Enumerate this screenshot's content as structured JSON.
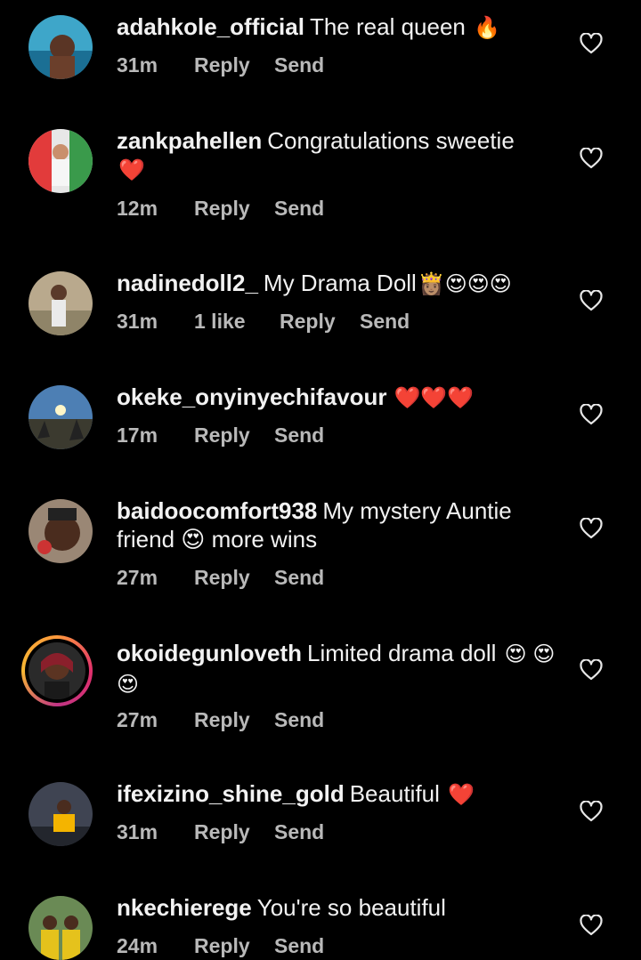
{
  "comments": [
    {
      "username": "adahkole_official",
      "text": "The real queen",
      "emoji": "🔥",
      "time": "31m",
      "likes": "",
      "reply": "Reply",
      "send": "Send"
    },
    {
      "username": "zankpahellen",
      "text": "Congratulations sweetie",
      "emoji": "❤️",
      "time": "12m",
      "likes": "",
      "reply": "Reply",
      "send": "Send"
    },
    {
      "username": "nadinedoll2_",
      "text": "My Drama Doll",
      "emoji": "👸🏽😍😍😍",
      "time": "31m",
      "likes": "1 like",
      "reply": "Reply",
      "send": "Send"
    },
    {
      "username": "okeke_onyinyechifavour",
      "text": "",
      "emoji": "❤️❤️❤️",
      "time": "17m",
      "likes": "",
      "reply": "Reply",
      "send": "Send"
    },
    {
      "username": "baidoocomfort938",
      "text": "My mystery Auntie friend 😍 more wins",
      "emoji": "",
      "time": "27m",
      "likes": "",
      "reply": "Reply",
      "send": "Send"
    },
    {
      "username": "okoidegunloveth",
      "text": "Limited drama doll",
      "emoji": "😍 😍😍",
      "time": "27m",
      "likes": "",
      "reply": "Reply",
      "send": "Send"
    },
    {
      "username": "ifexizino_shine_gold",
      "text": "Beautiful",
      "emoji": "❤️",
      "time": "31m",
      "likes": "",
      "reply": "Reply",
      "send": "Send"
    },
    {
      "username": "nkechierege",
      "text": "You're so beautiful",
      "emoji": "",
      "time": "24m",
      "likes": "",
      "reply": "Reply",
      "send": "Send"
    }
  ],
  "colors": {
    "background": "#000000",
    "text": "#f2f2f2",
    "meta": "#b9b9b9",
    "story_ring": "#e1306c"
  },
  "icons": {
    "like": "heart-outline-icon"
  }
}
